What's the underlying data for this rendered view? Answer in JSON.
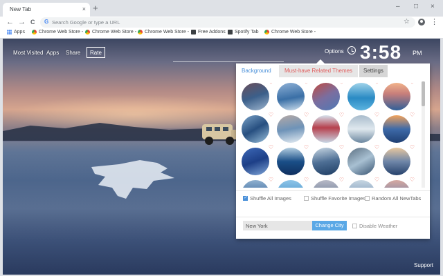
{
  "browser": {
    "tab_title": "New Tab",
    "tab_close": "×",
    "new_tab": "+",
    "window_controls": [
      "–",
      "□",
      "×"
    ],
    "back": "←",
    "forward": "→",
    "reload": "C",
    "omnibox_g": "G",
    "omnibox_placeholder": "Search Google or type a URL",
    "star": "☆",
    "menu": "⋮",
    "bookmarks": [
      {
        "label": "Apps",
        "icon": "apps-grid-icon"
      },
      {
        "label": "Chrome Web Store -",
        "icon": "chrome-web-store-icon"
      },
      {
        "label": "Chrome Web Store -",
        "icon": "chrome-web-store-icon"
      },
      {
        "label": "Chrome Web Store -",
        "icon": "chrome-web-store-icon"
      },
      {
        "label": "Free Addons",
        "icon": "free-addons-icon"
      },
      {
        "label": "Spotify Tab",
        "icon": "spotify-tab-icon"
      },
      {
        "label": "Chrome Web Store -",
        "icon": "chrome-web-store-icon"
      }
    ]
  },
  "page": {
    "nav": {
      "most_visited": "Most Visited",
      "apps": "Apps",
      "share": "Share",
      "rate": "Rate"
    },
    "options": "Options",
    "time": "3:58",
    "ampm": "PM",
    "support": "Support"
  },
  "panel": {
    "tabs": {
      "background": "Background",
      "related": "Must-have Related Themes",
      "settings": "Settings"
    },
    "heart": "♡",
    "thumbnails": [
      "linear-gradient(160deg,#6b4e5a,#3b5f8a 50%,#9fb6cf)",
      "linear-gradient(170deg,#8fb1d6,#3a6fa6 55%,#cfe0ee)",
      "linear-gradient(150deg,#c14a3f,#7a6ea0 50%,#4e79b5)",
      "linear-gradient(180deg,#9fd3ea,#2a8ac4 55%,#5cb4df)",
      "linear-gradient(180deg,#f2b38a,#c77e7b 40%,#2f5f98)",
      "linear-gradient(150deg,#7ba3c8,#274f80 50%,#9cc2dd)",
      "linear-gradient(170deg,#b5a9a5,#6e93b8 50%,#e6eef4)",
      "linear-gradient(180deg,#d7e3ee,#b6404d 45%,#c9d8e6)",
      "linear-gradient(180deg,#a9bccc,#dfe8ee 50%,#6b879f)",
      "linear-gradient(180deg,#f3a35c,#3e6aa8 50%,#1f3f73)",
      "linear-gradient(160deg,#3d69b8,#1d3f87 50%,#7fa6d8)",
      "linear-gradient(180deg,#b2cde0,#1a4f88 50%,#0f2f5e)",
      "linear-gradient(170deg,#c8d7e3,#4e6f95 50%,#1e3d63)",
      "linear-gradient(150deg,#5a6e80,#a8c0d2 50%,#34506e)",
      "linear-gradient(180deg,#e8c79f,#6f86a8 50%,#25416b)",
      "linear-gradient(180deg,#8fb0cf,#3b6aa0 60%,#bcd0e0)",
      "linear-gradient(180deg,#8dc4e8,#4c98cc 60%,#cfe5f3)",
      "linear-gradient(180deg,#b7b9c6,#6c7e99 60%,#2f4b6e)",
      "linear-gradient(180deg,#c7d6e2,#7c9bbb 60%,#34557d)",
      "linear-gradient(180deg,#d6a8a0,#7b86a8 60%,#3a5682)"
    ],
    "shuffle_all": "Shuffle All Images",
    "shuffle_favorite": "Shuffle Favorite Images",
    "random_all": "Random All NewTabs",
    "city_value": "New York",
    "change_city": "Change City",
    "disable_weather": "Disable Weather"
  }
}
